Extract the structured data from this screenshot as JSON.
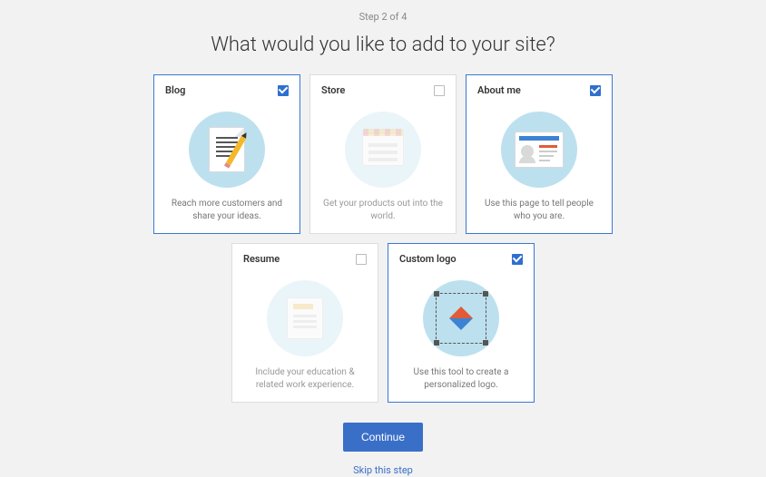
{
  "step": "Step 2 of 4",
  "title": "What would you like to add to your site?",
  "cards": [
    {
      "key": "blog",
      "title": "Blog",
      "desc": "Reach more customers and share your ideas.",
      "selected": true
    },
    {
      "key": "store",
      "title": "Store",
      "desc": "Get your products out into the world.",
      "selected": false
    },
    {
      "key": "about",
      "title": "About me",
      "desc": "Use this page to tell people who you are.",
      "selected": true
    },
    {
      "key": "resume",
      "title": "Resume",
      "desc": "Include your education & related work experience.",
      "selected": false
    },
    {
      "key": "logo",
      "title": "Custom logo",
      "desc": "Use this tool to create a personalized logo.",
      "selected": true
    }
  ],
  "actions": {
    "continue": "Continue",
    "skip": "Skip this step"
  }
}
